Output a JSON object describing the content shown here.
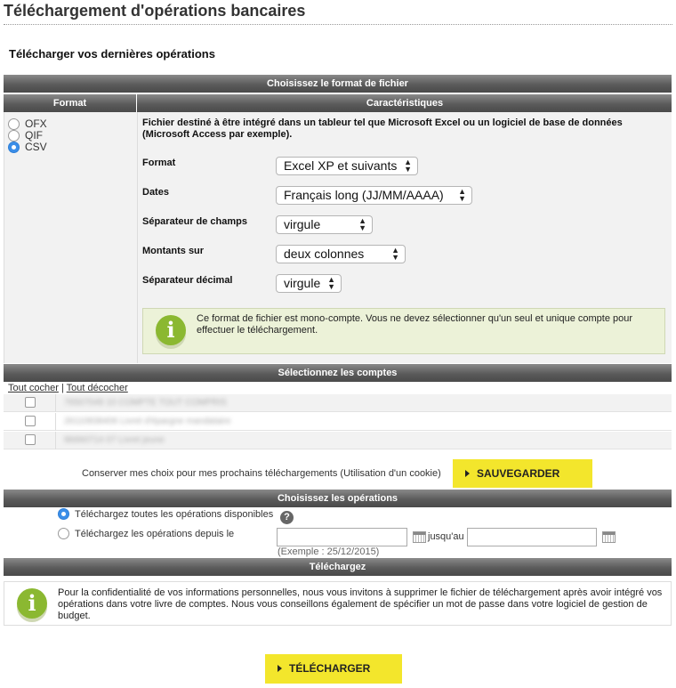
{
  "page": {
    "title": "Téléchargement d'opérations bancaires",
    "subtitle": "Télécharger vos dernières opérations"
  },
  "format_section": {
    "header": "Choisissez le format de fichier",
    "col_format": "Format",
    "col_features": "Caractéristiques",
    "options": [
      {
        "label": "OFX",
        "selected": false
      },
      {
        "label": "QIF",
        "selected": false
      },
      {
        "label": "CSV",
        "selected": true
      }
    ],
    "description": "Fichier destiné à être intégré dans un tableur tel que Microsoft Excel ou un logiciel de base de données (Microsoft Access par exemple).",
    "fields": [
      {
        "label": "Format",
        "value": "Excel XP et suivants"
      },
      {
        "label": "Dates",
        "value": "Français long (JJ/MM/AAAA)"
      },
      {
        "label": "Séparateur de champs",
        "value": "virgule"
      },
      {
        "label": "Montants sur",
        "value": "deux colonnes"
      },
      {
        "label": "Séparateur décimal",
        "value": "virgule"
      }
    ],
    "info": "Ce format de fichier est mono-compte. Vous ne devez sélectionner qu'un seul et unique compte pour effectuer le téléchargement."
  },
  "accounts_section": {
    "header": "Sélectionnez les comptes",
    "check_all": "Tout cocher",
    "separator": "|",
    "uncheck_all": "Tout décocher",
    "accounts": [
      {
        "name": "76507049 10 COMPTE TOUT COMPRIS",
        "checked": false
      },
      {
        "name": "26110838406 Livret d'épargne mandataire",
        "checked": false
      },
      {
        "name": "96660714 07 Livret jeune",
        "checked": false
      }
    ]
  },
  "save": {
    "text": "Conserver mes choix pour mes prochains téléchargements (Utilisation d'un cookie)",
    "button": "SAUVEGARDER"
  },
  "operations_section": {
    "header": "Choisissez les opérations",
    "option_all": "Téléchargez toutes les opérations disponibles",
    "option_since": "Téléchargez les opérations depuis le",
    "help_glyph": "?",
    "until_label": "jusqu'au",
    "from_value": "",
    "to_value": "",
    "example": "(Exemple : 25/12/2015)"
  },
  "download_section": {
    "header": "Téléchargez",
    "info": "Pour la confidentialité de vos informations personnelles, nous vous invitons à supprimer le fichier de téléchargement après avoir intégré vos opérations dans votre livre de comptes. Nous vous conseillons également de spécifier un mot de passe dans votre logiciel de gestion de budget.",
    "button": "TÉLÉCHARGER"
  },
  "icons": {
    "info": "info-icon",
    "calendar": "calendar-icon",
    "help": "help-icon",
    "play": "play-triangle-icon"
  },
  "colors": {
    "header_bar": "#5b5b5b",
    "button_yellow": "#f3e62c",
    "info_green": "#8bb831",
    "info_bg": "#ecf2d8",
    "radio_selected": "#3b8ee8"
  }
}
